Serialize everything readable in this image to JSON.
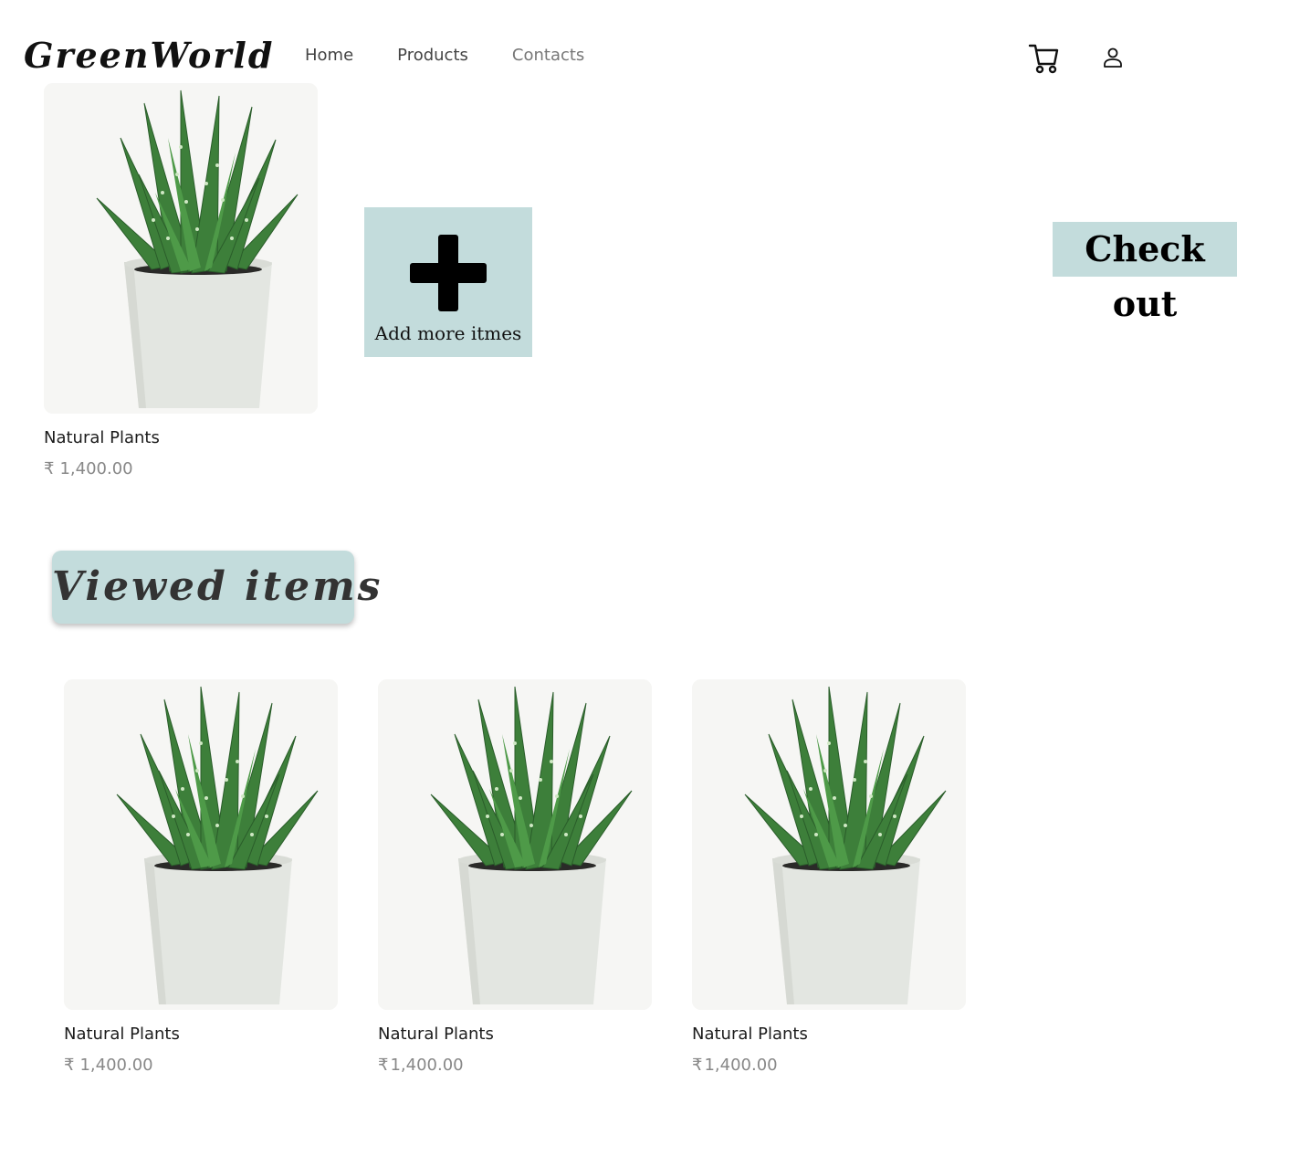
{
  "brand": {
    "logo": "GreenWorld"
  },
  "nav": {
    "items": [
      "Home",
      "Products",
      "Contacts"
    ]
  },
  "header_icons": {
    "cart": "shopping-cart-icon",
    "user": "user-profile-icon"
  },
  "cart": {
    "item": {
      "name": "Natural Plants",
      "currency": "₹",
      "price": "1,400.00"
    },
    "add_more_label": "Add more itmes",
    "checkout_label": "Check out"
  },
  "viewed": {
    "heading": "Viewed items",
    "items": [
      {
        "name": "Natural Plants",
        "currency": "₹",
        "price": "1,400.00"
      },
      {
        "name": "Natural Plants",
        "currency": "₹",
        "price": "1,400.00"
      },
      {
        "name": "Natural Plants",
        "currency": "₹",
        "price": "1,400.00"
      }
    ]
  },
  "colors": {
    "accent": "#c3dcdc",
    "leaf": "#3d7f3a",
    "pot": "#e3e6e1"
  }
}
